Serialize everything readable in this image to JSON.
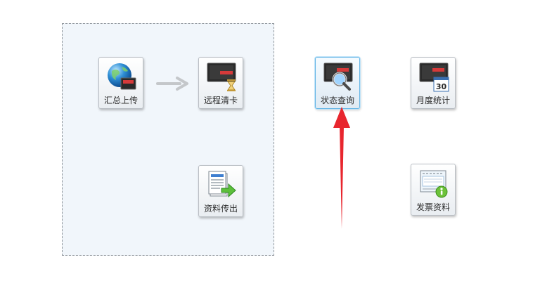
{
  "tiles": {
    "summary_upload": "汇总上传",
    "remote_clear_card": "远程清卡",
    "data_export": "资料传出",
    "status_query": "状态查询",
    "monthly_stats": "月度统计",
    "invoice_data": "发票资料"
  },
  "calendar_number": "30",
  "colors": {
    "panel_bg": "#f1f6fb",
    "selected_border": "#66b6e6",
    "annotation_arrow": "#e8262e"
  },
  "icons": {
    "summary_upload": "globe-monitor-icon",
    "remote_clear_card": "monitor-hourglass-icon",
    "data_export": "document-export-icon",
    "status_query": "monitor-magnifier-icon",
    "monthly_stats": "monitor-calendar-icon",
    "invoice_data": "invoice-info-icon"
  }
}
